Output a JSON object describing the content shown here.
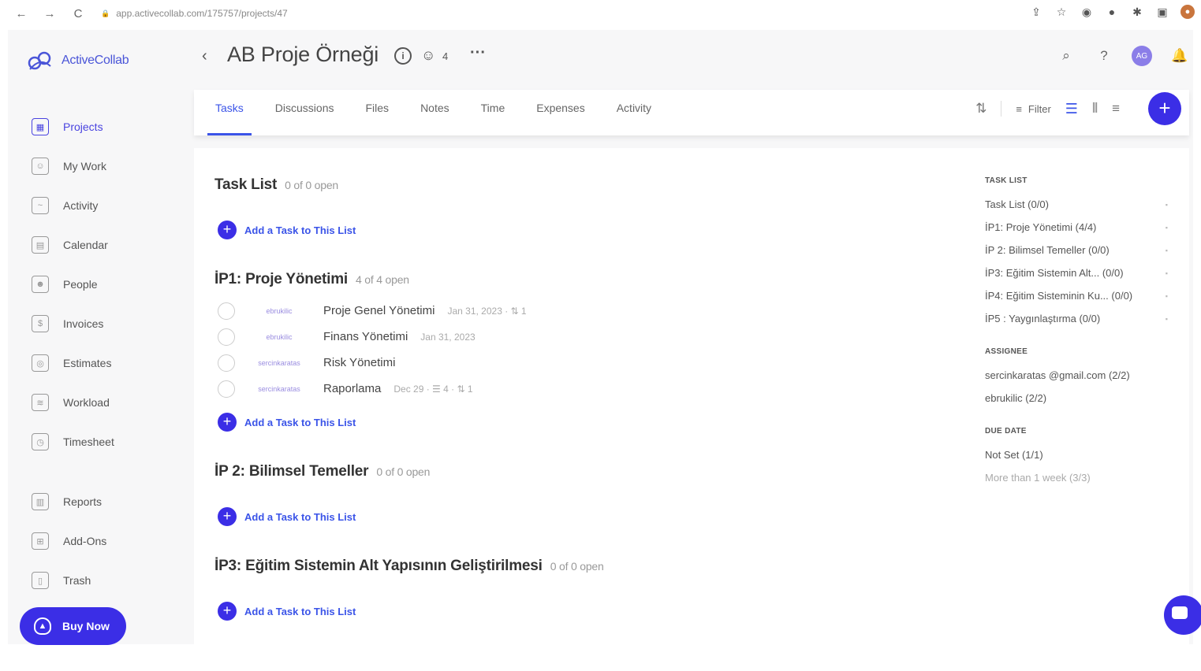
{
  "browser": {
    "back": "←",
    "forward": "→",
    "reload": "C",
    "lock": "🔒",
    "url": "app.activecollab.com/175757/projects/47"
  },
  "sidebar": {
    "logo_text": "ActiveCollab",
    "items": [
      {
        "label": "Projects",
        "icon": "grid-icon",
        "glyph": "▦",
        "active": true
      },
      {
        "label": "My Work",
        "icon": "user-card-icon",
        "glyph": "☺",
        "active": false
      },
      {
        "label": "Activity",
        "icon": "activity-icon",
        "glyph": "~",
        "active": false
      },
      {
        "label": "Calendar",
        "icon": "calendar-icon",
        "glyph": "▤",
        "active": false
      },
      {
        "label": "People",
        "icon": "people-icon",
        "glyph": "☻",
        "active": false
      },
      {
        "label": "Invoices",
        "icon": "invoice-icon",
        "glyph": "$",
        "active": false
      },
      {
        "label": "Estimates",
        "icon": "estimate-icon",
        "glyph": "◎",
        "active": false
      },
      {
        "label": "Workload",
        "icon": "workload-icon",
        "glyph": "≋",
        "active": false
      },
      {
        "label": "Timesheet",
        "icon": "timesheet-icon",
        "glyph": "◷",
        "active": false
      }
    ],
    "items2": [
      {
        "label": "Reports",
        "icon": "reports-icon",
        "glyph": "▥"
      },
      {
        "label": "Add-Ons",
        "icon": "addons-icon",
        "glyph": "⊞"
      },
      {
        "label": "Trash",
        "icon": "trash-icon",
        "glyph": "▯"
      }
    ],
    "buy_now": "Buy Now"
  },
  "header": {
    "back": "‹",
    "title": "AB Proje Örneği",
    "people_count": "4",
    "avatar_initials": "AG"
  },
  "tabs": [
    "Tasks",
    "Discussions",
    "Files",
    "Notes",
    "Time",
    "Expenses",
    "Activity"
  ],
  "active_tab": "Tasks",
  "toolbar": {
    "filter_label": "Filter",
    "add": "+"
  },
  "task_lists": [
    {
      "title": "Task List",
      "count": "0 of 0 open",
      "tasks": []
    },
    {
      "title": "İP1: Proje Yönetimi",
      "count": "4 of 4 open",
      "tasks": [
        {
          "assignee": "ebrukilic",
          "name": "Proje Genel Yönetimi",
          "meta": "Jan 31, 2023 · ⇅ 1"
        },
        {
          "assignee": "ebrukilic",
          "name": "Finans Yönetimi",
          "meta": "Jan 31, 2023"
        },
        {
          "assignee": "sercinkaratas",
          "name": "Risk Yönetimi",
          "meta": ""
        },
        {
          "assignee": "sercinkaratas",
          "name": "Raporlama",
          "meta": "Dec 29 · ☰ 4 · ⇅ 1"
        }
      ]
    },
    {
      "title": "İP 2: Bilimsel Temeller",
      "count": "0 of 0 open",
      "tasks": []
    },
    {
      "title": "İP3: Eğitim Sistemin Alt Yapısının Geliştirilmesi",
      "count": "0 of 0 open",
      "tasks": []
    }
  ],
  "add_task_label": "Add a Task to This List",
  "panel": {
    "task_list_head": "TASK LIST",
    "task_list_items": [
      "Task List (0/0)",
      "İP1: Proje Yönetimi (4/4)",
      "İP 2: Bilimsel Temeller (0/0)",
      "İP3: Eğitim Sistemin Alt... (0/0)",
      "İP4: Eğitim Sisteminin Ku... (0/0)",
      "İP5 : Yaygınlaştırma (0/0)"
    ],
    "assignee_head": "ASSIGNEE",
    "assignee_items": [
      "sercinkaratas @gmail.com (2/2)",
      "ebrukilic (2/2)"
    ],
    "due_head": "DUE DATE",
    "due_items": [
      "Not Set (1/1)",
      "More than 1 week (3/3)"
    ]
  }
}
